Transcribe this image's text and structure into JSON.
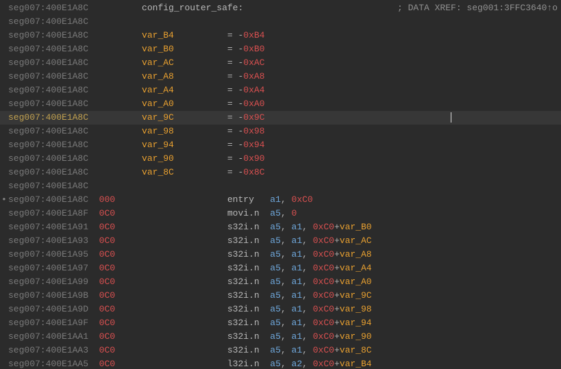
{
  "xref_comment": "; DATA XREF: seg001:3FFC3640↑o",
  "func_label": "config_router_safe:",
  "addr_base": "seg007:400E1A8C",
  "vars": [
    {
      "name": "var_B4",
      "val": "0xB4"
    },
    {
      "name": "var_B0",
      "val": "0xB0"
    },
    {
      "name": "var_AC",
      "val": "0xAC"
    },
    {
      "name": "var_A8",
      "val": "0xA8"
    },
    {
      "name": "var_A4",
      "val": "0xA4"
    },
    {
      "name": "var_A0",
      "val": "0xA0"
    },
    {
      "name": "var_9C",
      "val": "0x9C"
    },
    {
      "name": "var_98",
      "val": "0x98"
    },
    {
      "name": "var_94",
      "val": "0x94"
    },
    {
      "name": "var_90",
      "val": "0x90"
    },
    {
      "name": "var_8C",
      "val": "0x8C"
    }
  ],
  "instrs": [
    {
      "addr": "seg007:400E1A8C",
      "stk": "000",
      "mn": "entry",
      "ops": [
        {
          "t": "reg",
          "v": "a1"
        },
        {
          "t": "hexred",
          "v": "0xC0"
        }
      ],
      "mark": true
    },
    {
      "addr": "seg007:400E1A8F",
      "stk": "0C0",
      "mn": "movi.n",
      "ops": [
        {
          "t": "reg",
          "v": "a5"
        },
        {
          "t": "hexred",
          "v": "0"
        }
      ]
    },
    {
      "addr": "seg007:400E1A91",
      "stk": "0C0",
      "mn": "s32i.n",
      "ops": [
        {
          "t": "reg",
          "v": "a5"
        },
        {
          "t": "reg",
          "v": "a1"
        },
        {
          "t": "sum",
          "c": "0xC0",
          "v": "var_B0"
        }
      ]
    },
    {
      "addr": "seg007:400E1A93",
      "stk": "0C0",
      "mn": "s32i.n",
      "ops": [
        {
          "t": "reg",
          "v": "a5"
        },
        {
          "t": "reg",
          "v": "a1"
        },
        {
          "t": "sum",
          "c": "0xC0",
          "v": "var_AC"
        }
      ]
    },
    {
      "addr": "seg007:400E1A95",
      "stk": "0C0",
      "mn": "s32i.n",
      "ops": [
        {
          "t": "reg",
          "v": "a5"
        },
        {
          "t": "reg",
          "v": "a1"
        },
        {
          "t": "sum",
          "c": "0xC0",
          "v": "var_A8"
        }
      ]
    },
    {
      "addr": "seg007:400E1A97",
      "stk": "0C0",
      "mn": "s32i.n",
      "ops": [
        {
          "t": "reg",
          "v": "a5"
        },
        {
          "t": "reg",
          "v": "a1"
        },
        {
          "t": "sum",
          "c": "0xC0",
          "v": "var_A4"
        }
      ]
    },
    {
      "addr": "seg007:400E1A99",
      "stk": "0C0",
      "mn": "s32i.n",
      "ops": [
        {
          "t": "reg",
          "v": "a5"
        },
        {
          "t": "reg",
          "v": "a1"
        },
        {
          "t": "sum",
          "c": "0xC0",
          "v": "var_A0"
        }
      ]
    },
    {
      "addr": "seg007:400E1A9B",
      "stk": "0C0",
      "mn": "s32i.n",
      "ops": [
        {
          "t": "reg",
          "v": "a5"
        },
        {
          "t": "reg",
          "v": "a1"
        },
        {
          "t": "sum",
          "c": "0xC0",
          "v": "var_9C"
        }
      ]
    },
    {
      "addr": "seg007:400E1A9D",
      "stk": "0C0",
      "mn": "s32i.n",
      "ops": [
        {
          "t": "reg",
          "v": "a5"
        },
        {
          "t": "reg",
          "v": "a1"
        },
        {
          "t": "sum",
          "c": "0xC0",
          "v": "var_98"
        }
      ]
    },
    {
      "addr": "seg007:400E1A9F",
      "stk": "0C0",
      "mn": "s32i.n",
      "ops": [
        {
          "t": "reg",
          "v": "a5"
        },
        {
          "t": "reg",
          "v": "a1"
        },
        {
          "t": "sum",
          "c": "0xC0",
          "v": "var_94"
        }
      ]
    },
    {
      "addr": "seg007:400E1AA1",
      "stk": "0C0",
      "mn": "s32i.n",
      "ops": [
        {
          "t": "reg",
          "v": "a5"
        },
        {
          "t": "reg",
          "v": "a1"
        },
        {
          "t": "sum",
          "c": "0xC0",
          "v": "var_90"
        }
      ]
    },
    {
      "addr": "seg007:400E1AA3",
      "stk": "0C0",
      "mn": "s32i.n",
      "ops": [
        {
          "t": "reg",
          "v": "a5"
        },
        {
          "t": "reg",
          "v": "a1"
        },
        {
          "t": "sum",
          "c": "0xC0",
          "v": "var_8C"
        }
      ]
    },
    {
      "addr": "seg007:400E1AA5",
      "stk": "0C0",
      "mn": "l32i.n",
      "ops": [
        {
          "t": "reg",
          "v": "a5"
        },
        {
          "t": "reg",
          "v": "a2"
        },
        {
          "t": "sum",
          "c": "0xC0",
          "v": "var_B4"
        }
      ]
    }
  ],
  "highlighted_var_index": 6,
  "eq_sign": "= -"
}
